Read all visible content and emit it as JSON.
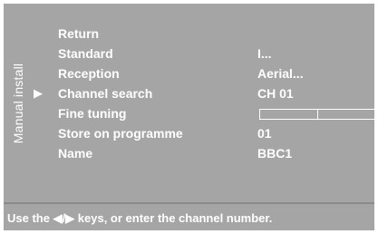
{
  "side_tab": {
    "label": "Manual install"
  },
  "selected_arrow": "▶",
  "menu": [
    {
      "label": "Return",
      "value": ""
    },
    {
      "label": "Standard",
      "value": "I..."
    },
    {
      "label": "Reception",
      "value": "Aerial..."
    },
    {
      "label": "Channel search",
      "value": "CH 01"
    },
    {
      "label": "Fine tuning",
      "value": ""
    },
    {
      "label": "Store on programme",
      "value": "01"
    },
    {
      "label": "Name",
      "value": "BBC1"
    }
  ],
  "selected_index": 3,
  "fine_tuning": {
    "level": 0.5
  },
  "help": {
    "text": "Use the ◀/▶ keys, or enter the channel number."
  },
  "colors": {
    "background": "#a5a5a5",
    "text": "#ffffff"
  }
}
